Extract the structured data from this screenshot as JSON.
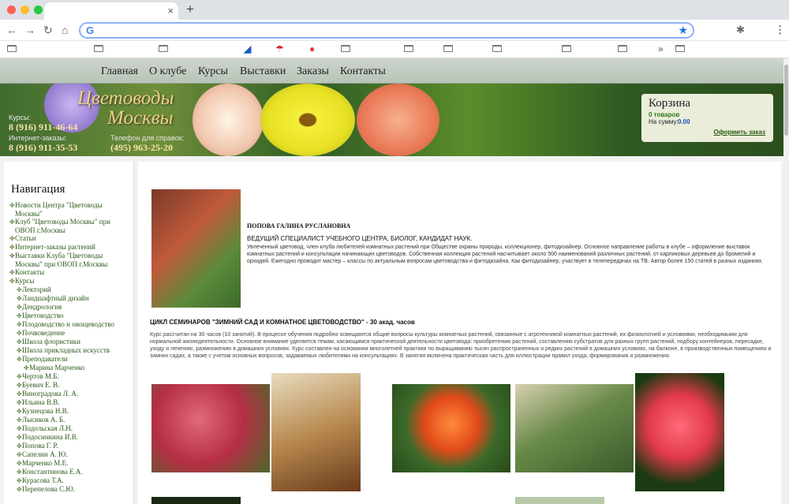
{
  "browser": {
    "colors": {
      "close": "#ff5f57",
      "minimize": "#febc2e",
      "maximize": "#28c840"
    },
    "tab_close": "×",
    "new_tab": "+",
    "nav": {
      "back": "←",
      "forward": "→",
      "reload": "↻",
      "home": "⌂"
    },
    "omnibox": {
      "g": "G",
      "star": "★"
    },
    "extensions": {
      "puzzle": "✱",
      "menu": "⋮"
    },
    "bookmarks_overflow": "»"
  },
  "menu": {
    "items": [
      "Главная",
      "О клубе",
      "Курсы",
      "Выставки",
      "Заказы",
      "Контакты"
    ]
  },
  "header": {
    "logo_line1": "Цветоводы",
    "logo_line2": "Москвы",
    "courses_label": "Курсы:",
    "courses_phone": "8 (916) 911-46-64",
    "orders_label": "Интернет-заказы:",
    "orders_phone": "8 (916) 911-35-53",
    "info_label": "Телефон для справок:",
    "info_phone": "(495) 963-25-20"
  },
  "cart": {
    "title": "Корзина",
    "items": "0 товаров",
    "sum_label": "На сумму:",
    "sum_value": "0.00",
    "checkout": "Оформить заказ"
  },
  "sidebar": {
    "title": "Навигация",
    "items": [
      {
        "label": "Новости Центра \"Цветоводы",
        "indent": 0
      },
      {
        "label": "Москвы\"",
        "indent": 0,
        "cont": true
      },
      {
        "label": "Клуб \"Цветоводы Москвы\" при",
        "indent": 0
      },
      {
        "label": "ОВОП г.Москвы",
        "indent": 0,
        "cont": true
      },
      {
        "label": "Статьи",
        "indent": 0
      },
      {
        "label": "Интернет-заказы растений",
        "indent": 0
      },
      {
        "label": "Выставки Клуба \"Цветоводы",
        "indent": 0
      },
      {
        "label": "Москвы\" при ОВОП г.Москвы",
        "indent": 0,
        "cont": true
      },
      {
        "label": "Контакты",
        "indent": 0
      },
      {
        "label": "Курсы",
        "indent": 0
      },
      {
        "label": "Лекторий",
        "indent": 1
      },
      {
        "label": "Ландшафтный дизайн",
        "indent": 1
      },
      {
        "label": "Дендрология",
        "indent": 1
      },
      {
        "label": "Цветоводство",
        "indent": 1
      },
      {
        "label": "Плодоводство и овощеводство",
        "indent": 1
      },
      {
        "label": "Почвоведение",
        "indent": 1
      },
      {
        "label": "Школа флористики",
        "indent": 1
      },
      {
        "label": "Школа прикладных искусств",
        "indent": 1
      },
      {
        "label": "Преподаватели",
        "indent": 1
      },
      {
        "label": "Марина Марченко",
        "indent": 2
      },
      {
        "label": "Чертов М.Б.",
        "indent": 1
      },
      {
        "label": "Буевич Е. В.",
        "indent": 1
      },
      {
        "label": "Виноградова Л. А.",
        "indent": 1
      },
      {
        "label": "Ильина В.В.",
        "indent": 1
      },
      {
        "label": "Кузнецова Н.В.",
        "indent": 1
      },
      {
        "label": "Лысиков А. Б.",
        "indent": 1
      },
      {
        "label": "Подольская Л.Н.",
        "indent": 1
      },
      {
        "label": "Подосинкина И.В.",
        "indent": 1
      },
      {
        "label": "Попова Г. Р.",
        "indent": 1
      },
      {
        "label": "Сапелин А. Ю.",
        "indent": 1
      },
      {
        "label": "Марченко М.Е.",
        "indent": 1
      },
      {
        "label": "Константинова Е.А.",
        "indent": 1
      },
      {
        "label": "Курасова Т.А.",
        "indent": 1
      },
      {
        "label": "Перепелова С.Ю.",
        "indent": 1
      }
    ]
  },
  "bio": {
    "name": "ПОПОВА ГАЛИНА РУСЛАНОВНА",
    "title": "ВЕДУЩИЙ СПЕЦИАЛИСТ УЧЕБНОГО ЦЕНТРА, БИОЛОГ, КАНДИДАТ НАУК.",
    "text": "Увлеченный цветовод, член клуба любителей комнатных растений при Обществе охраны природы, коллекционер, фитодизайнер. Основное направление работы в клубе – оформление выставок комнатных растений и консультации начинающих цветоводов. Собственная коллекция растений насчитывает около 500 наименований различных растений, от карликовых деревьев до бромелий и орхидей. Ежегодно проводит мастер – классы по актуальным вопросам цветоводства и фитодизайна. Как фитодизайнер, участвует в телепередачах на ТВ. Автор более 150 статей в разных изданиях."
  },
  "course": {
    "heading": "ЦИКЛ СЕМИНАРОВ \"ЗИМНИЙ САД И КОМНАТНОЕ ЦВЕТОВОДСТВО\"  - 30 акад. часов",
    "text": "Курс рассчитан на 30 часов (10 занятий). В процессе обучения подробно освещаются общие вопросы культуры комнатных растений, связанные с агротехникой комнатных растений, их физиологией и условиями, необходимыми для нормальной жизнедеятельности. Основное внимание уделяется темам, касающимся практической деятельности цветовода: приобретению растений, составлению субстратов для разных групп растений, подбору контейнеров, пересадке, уходу и лечению, размножению в домашних условиях. Курс составлен на основании многолетней практики по выращиванию тысяч распространенных и редких растений в домашних условиях, на балконе, в производственных помещениях и зимних садах, а также с учетом основных вопросов, задаваемых любителями на консультациях. В занятия включена практическая часть для иллюстрации правил ухода, формирования и размножения."
  }
}
